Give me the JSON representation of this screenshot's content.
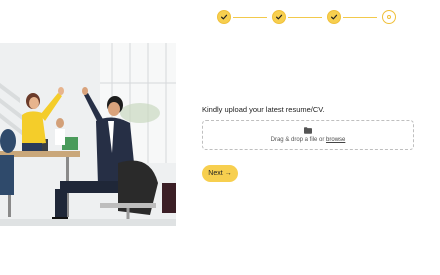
{
  "stepper": {
    "steps": [
      {
        "status": "completed",
        "icon": "check-icon"
      },
      {
        "status": "completed",
        "icon": "check-icon"
      },
      {
        "status": "completed",
        "icon": "check-icon"
      },
      {
        "status": "current",
        "icon": "dot-icon"
      }
    ],
    "accent_color": "#f7cf4f"
  },
  "hero": {
    "image": "office-team-high-five-photo"
  },
  "upload": {
    "prompt": "Kindly upload your latest resume/CV.",
    "drop_text": "Drag & drop a file or",
    "browse_label": "browse",
    "icon": "folder-icon"
  },
  "actions": {
    "next_label": "Next",
    "next_icon": "→"
  }
}
